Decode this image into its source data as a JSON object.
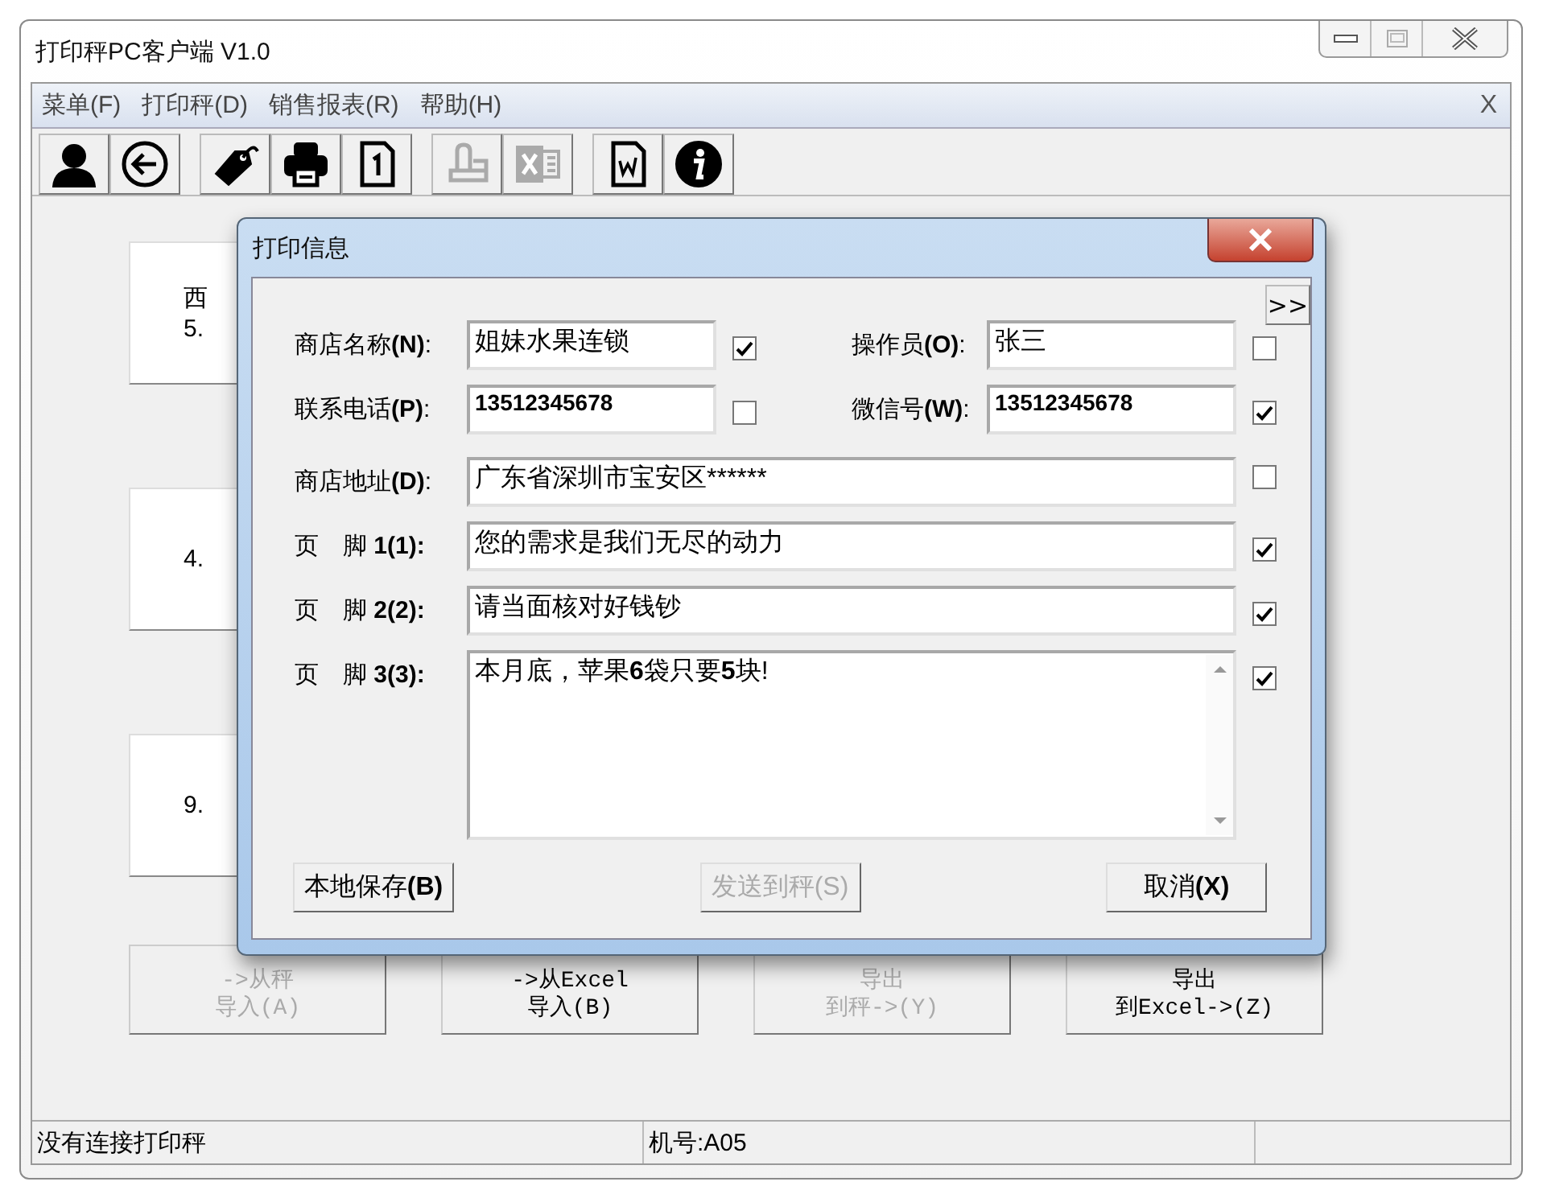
{
  "window": {
    "title": "打印秤PC客户端 V1.0"
  },
  "menu": {
    "items": [
      "菜单(F)",
      "打印秤(D)",
      "销售报表(R)",
      "帮助(H)"
    ],
    "close": "X"
  },
  "toolbar": [
    [
      {
        "kind": "user",
        "disabled": false
      },
      {
        "kind": "back",
        "disabled": false
      }
    ],
    [
      {
        "kind": "tag",
        "disabled": false
      },
      {
        "kind": "printer",
        "disabled": false
      },
      {
        "kind": "page",
        "disabled": false
      }
    ],
    [
      {
        "kind": "scale",
        "disabled": true
      },
      {
        "kind": "excel",
        "disabled": true
      }
    ],
    [
      {
        "kind": "word",
        "disabled": false
      },
      {
        "kind": "info",
        "disabled": false
      }
    ]
  ],
  "tiles": [
    {
      "lines": [
        "西",
        "5."
      ]
    },
    {
      "lines": [
        "4."
      ]
    },
    {
      "lines": [
        "9."
      ]
    }
  ],
  "bottom_buttons": [
    {
      "lines": [
        "->从秤",
        "导入(A)"
      ],
      "disabled": true
    },
    {
      "lines": [
        "->从Excel",
        "导入(B)"
      ],
      "disabled": false
    },
    {
      "lines": [
        "导出",
        "到秤->(Y)"
      ],
      "disabled": true
    },
    {
      "lines": [
        "导出",
        "到Excel->(Z)"
      ],
      "disabled": false
    }
  ],
  "dialog": {
    "title": "打印信息",
    "more": ">>",
    "pair_rows": [
      [
        {
          "label": "商店名称**(N)**:",
          "value": "姐妹水果连锁",
          "checked": true
        },
        {
          "label": "操作员**(O)**:",
          "value": "张三",
          "checked": false
        }
      ],
      [
        {
          "label": "联系电话**(P)**:",
          "value": "13512345678",
          "checked": false
        },
        {
          "label": "微信号**(W)**:",
          "value": "13512345678",
          "checked": true
        }
      ]
    ],
    "wide_rows": [
      {
        "label": "商店地址**(D)**:",
        "value": "广东省深圳市宝安区******",
        "checked": false,
        "kind": "line"
      },
      {
        "label": "页　脚 **1(1):**",
        "value": "您的需求是我们无尽的动力",
        "checked": true,
        "kind": "line"
      },
      {
        "label": "页　脚 **2(2):**",
        "value": "请当面核对好钱钞",
        "checked": true,
        "kind": "line"
      },
      {
        "label": "页　脚 **3(3):**",
        "value": "本月底，苹果**6**袋只要**5**块!",
        "checked": true,
        "kind": "area"
      }
    ],
    "buttons": [
      {
        "label": "本地保存**(B)**",
        "disabled": false
      },
      {
        "label": "发送到秤(S)",
        "disabled": true
      },
      {
        "label": "取消**(X)**",
        "disabled": false
      }
    ]
  },
  "status_bar": [
    "没有连接打印秤",
    "机号:A05"
  ]
}
